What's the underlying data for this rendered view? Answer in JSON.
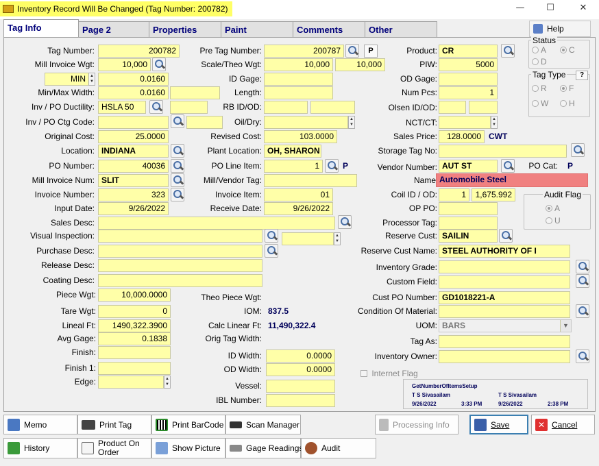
{
  "window": {
    "title": "Inventory Record Will Be Changed  (Tag Number: 200782)",
    "minimize": "—",
    "maximize": "☐",
    "close": "✕"
  },
  "tabs": [
    "Tag Info",
    "Page 2",
    "Properties",
    "Paint",
    "Comments",
    "Other"
  ],
  "help_label": "Help",
  "left": {
    "tag_number": {
      "label": "Tag Number:",
      "value": "200782"
    },
    "mill_invoice_wgt": {
      "label": "Mill Invoice Wgt:",
      "value": "10,000"
    },
    "min_max": {
      "mode": "MIN",
      "value": "0.0160"
    },
    "min_max_width": {
      "label": "Min/Max Width:",
      "value": "0.0160"
    },
    "ductility": {
      "label": "Inv / PO Ductility:",
      "value": "HSLA 50"
    },
    "ctg_code": {
      "label": "Inv / PO Ctg Code:",
      "value": ""
    },
    "original_cost": {
      "label": "Original Cost:",
      "value": "25.0000"
    },
    "location": {
      "label": "Location:",
      "value": "INDIANA"
    },
    "po_number": {
      "label": "PO Number:",
      "value": "40036"
    },
    "mill_invoice_num": {
      "label": "Mill Invoice Num:",
      "value": "SLIT"
    },
    "invoice_number": {
      "label": "Invoice Number:",
      "value": "323"
    },
    "input_date": {
      "label": "Input Date:",
      "value": "9/26/2022"
    },
    "sales_desc": {
      "label": "Sales Desc:",
      "value": ""
    },
    "visual_inspection": {
      "label": "Visual Inspection:",
      "value": ""
    },
    "purchase_desc": {
      "label": "Purchase Desc:",
      "value": ""
    },
    "release_desc": {
      "label": "Release Desc:",
      "value": ""
    },
    "coating_desc": {
      "label": "Coating Desc:",
      "value": ""
    },
    "piece_wgt": {
      "label": "Piece Wgt:",
      "value": "10,000.0000"
    },
    "tare_wgt": {
      "label": "Tare Wgt:",
      "value": "0"
    },
    "lineal_ft": {
      "label": "Lineal Ft:",
      "value": "1490,322.3900"
    },
    "avg_gage": {
      "label": "Avg Gage:",
      "value": "0.1838"
    },
    "finish": {
      "label": "Finish:",
      "value": ""
    },
    "finish1": {
      "label": "Finish 1:",
      "value": ""
    },
    "edge": {
      "label": "Edge:",
      "value": ""
    }
  },
  "middle": {
    "pre_tag_number": {
      "label": "Pre Tag Number:",
      "value": "200787",
      "p": "P"
    },
    "scale_theo_wgt": {
      "label": "Scale/Theo Wgt:",
      "value1": "10,000",
      "value2": "10,000"
    },
    "id_gage": {
      "label": "ID Gage:",
      "value": ""
    },
    "length": {
      "label": "Length:",
      "value": ""
    },
    "rb_id_od": {
      "label": "RB ID/OD:",
      "value": ""
    },
    "oil_dry": {
      "label": "Oil/Dry:",
      "value": ""
    },
    "revised_cost": {
      "label": "Revised Cost:",
      "value": "103.0000"
    },
    "plant_location": {
      "label": "Plant Location:",
      "value": "OH, SHARON"
    },
    "po_line_item": {
      "label": "PO Line Item:",
      "value": "1",
      "p": "P"
    },
    "mill_vendor_tag": {
      "label": "Mill/Vendor Tag:",
      "value": ""
    },
    "invoice_item": {
      "label": "Invoice Item:",
      "value": "01"
    },
    "receive_date": {
      "label": "Receive Date:",
      "value": "9/26/2022"
    },
    "theo_piece_wgt": {
      "label": "Theo Piece Wgt:",
      "value": ""
    },
    "iom": {
      "label": "IOM:",
      "value": "837.5"
    },
    "calc_linear_ft": {
      "label": "Calc Linear Ft:",
      "value": "11,490,322.4"
    },
    "orig_tag_width": {
      "label": "Orig Tag Width:",
      "value": ""
    },
    "id_width": {
      "label": "ID Width:",
      "value": "0.0000"
    },
    "od_width": {
      "label": "OD Width:",
      "value": "0.0000"
    },
    "vessel": {
      "label": "Vessel:",
      "value": ""
    },
    "ibl_number": {
      "label": "IBL Number:",
      "value": ""
    }
  },
  "right": {
    "product": {
      "label": "Product:",
      "value": "CR"
    },
    "piw": {
      "label": "PIW:",
      "value": "5000"
    },
    "od_gage": {
      "label": "OD Gage:",
      "value": ""
    },
    "num_pcs": {
      "label": "Num Pcs:",
      "value": "1"
    },
    "olsen_id_od": {
      "label": "Olsen ID/OD:",
      "value": ""
    },
    "nct_ct": {
      "label": "NCT/CT:",
      "value": ""
    },
    "sales_price": {
      "label": "Sales Price:",
      "value": "128.0000",
      "unit": "CWT"
    },
    "storage_tag_no": {
      "label": "Storage Tag No:",
      "value": ""
    },
    "vendor_number": {
      "label": "Vendor Number:",
      "value": "AUT ST"
    },
    "po_cat": {
      "label": "PO Cat:",
      "value": "P"
    },
    "name": {
      "label": "Name",
      "value": "Automobile Steel"
    },
    "coil_id_od": {
      "label": "Coil ID / OD:",
      "value1": "1",
      "value2": "1,675.992"
    },
    "op_po": {
      "label": "OP PO:",
      "value": ""
    },
    "processor_tag": {
      "label": "Processor Tag:",
      "value": ""
    },
    "reserve_cust": {
      "label": "Reserve Cust:",
      "value": "SAILIN"
    },
    "reserve_cust_name": {
      "label": "Reserve Cust Name:",
      "value": "STEEL AUTHORITY OF I"
    },
    "inventory_grade": {
      "label": "Inventory Grade:",
      "value": ""
    },
    "custom_field": {
      "label": "Custom Field:",
      "value": ""
    },
    "cust_po_number": {
      "label": "Cust PO Number:",
      "value": "GD1018221-A"
    },
    "condition_of_material": {
      "label": "Condition Of Material:",
      "value": ""
    },
    "uom": {
      "label": "UOM:",
      "value": "BARS"
    },
    "tag_as": {
      "label": "Tag As:",
      "value": ""
    },
    "inventory_owner": {
      "label": "Inventory Owner:",
      "value": ""
    },
    "internet_flag": "Internet Flag"
  },
  "status_group": {
    "title": "Status",
    "options": [
      "A",
      "C",
      "D"
    ],
    "selected": "C"
  },
  "tag_type_group": {
    "title": "Tag Type",
    "help": "?",
    "options": [
      "R",
      "F",
      "W",
      "H"
    ],
    "selected": "F"
  },
  "audit_flag_group": {
    "title": "Audit Flag",
    "options": [
      "A",
      "U"
    ],
    "selected": "A"
  },
  "audit_info": {
    "setup": "GetNumberOfItemsSetup",
    "user1": "T S Sivasailam",
    "date1": "9/26/2022",
    "time1": "3:33 PM",
    "user2": "T S Sivasailam",
    "date2": "9/26/2022",
    "time2": "2:38 PM"
  },
  "buttons": {
    "memo": "Memo",
    "print_tag": "Print Tag",
    "print_barcode": "Print BarCode",
    "scan_manager": "Scan Manager",
    "processing_info": "Processing Info",
    "save": "Save",
    "cancel": "Cancel",
    "history": "History",
    "product_on_order": "Product On Order",
    "show_picture": "Show Picture",
    "gage_readings": "Gage Readings",
    "audit": "Audit"
  },
  "colors": {
    "field": "#ffffa8",
    "name_field": "#f08080",
    "title_highlight": "#ffff66",
    "value_text": "#00005a"
  }
}
